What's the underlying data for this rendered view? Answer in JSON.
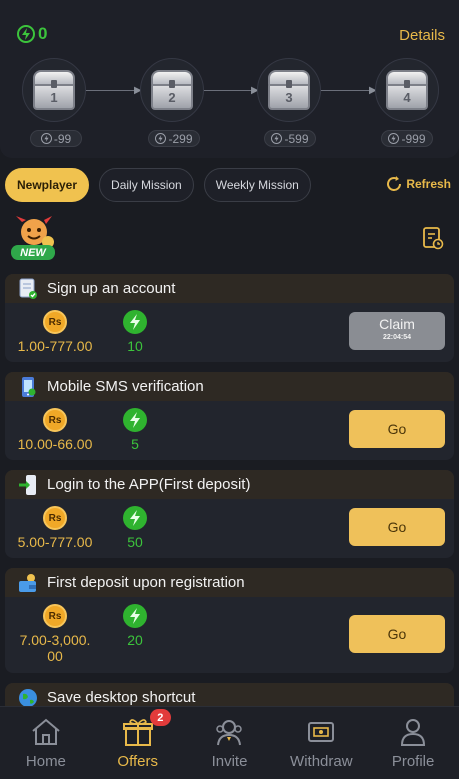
{
  "progress": {
    "energy_count": "0",
    "details_label": "Details",
    "chests": [
      {
        "number": "1",
        "threshold": "-99"
      },
      {
        "number": "2",
        "threshold": "-299"
      },
      {
        "number": "3",
        "threshold": "-599"
      },
      {
        "number": "4",
        "threshold": "-999"
      }
    ]
  },
  "tabs": [
    {
      "label": "Newplayer",
      "active": true
    },
    {
      "label": "Daily Mission",
      "active": false
    },
    {
      "label": "Weekly Mission",
      "active": false
    }
  ],
  "refresh_label": "Refresh",
  "new_badge_label": "NEW",
  "missions": [
    {
      "title": "Sign up an account",
      "rs_label": "Rs",
      "rs_value": "1.00-777.00",
      "energy_value": "10",
      "action_label": "Claim",
      "action_timer": "22:04:54"
    },
    {
      "title": "Mobile SMS verification",
      "rs_label": "Rs",
      "rs_value": "10.00-66.00",
      "energy_value": "5",
      "action_label": "Go"
    },
    {
      "title": "Login to the APP(First deposit)",
      "rs_label": "Rs",
      "rs_value": "5.00-777.00",
      "energy_value": "50",
      "action_label": "Go"
    },
    {
      "title": "First deposit upon registration",
      "rs_label": "Rs",
      "rs_value": "7.00-3,000.00",
      "energy_value": "20",
      "action_label": "Go"
    },
    {
      "title": "Save desktop shortcut"
    }
  ],
  "nav": {
    "items": [
      {
        "label": "Home",
        "icon": "home-icon"
      },
      {
        "label": "Offers",
        "icon": "gift-icon",
        "badge": "2",
        "active": true
      },
      {
        "label": "Invite",
        "icon": "invite-icon"
      },
      {
        "label": "Withdraw",
        "icon": "withdraw-icon"
      },
      {
        "label": "Profile",
        "icon": "profile-icon"
      }
    ]
  },
  "colors": {
    "background": "#1a1c22",
    "accent_gold": "#e8b94a",
    "energy_green": "#3cc43c",
    "button_gold": "#efc15a",
    "badge_red": "#e23b3b"
  }
}
